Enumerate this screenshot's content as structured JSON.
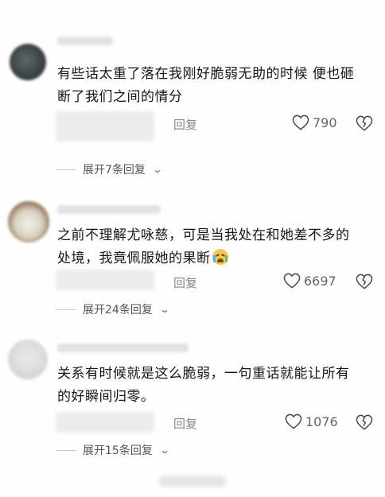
{
  "colors": {
    "background": "#fefefe",
    "text": "#161616",
    "secondary": "#888888",
    "heart_stroke": "#444444"
  },
  "comments": [
    {
      "text_line1": "有些话太重了落在我刚好脆弱无助的时候 便也砸",
      "text_line2": "断了我们之间的情分",
      "emoji": "",
      "reply_label": "回复",
      "likes": "790",
      "expand_label": "展开7条回复"
    },
    {
      "text_line1": "之前不理解尤咏慈，可是当我处在和她差不多的",
      "text_line2": "处境，我竟佩服她的果断",
      "emoji": "crying-face-emoji",
      "reply_label": "回复",
      "likes": "6697",
      "expand_label": "展开24条回复"
    },
    {
      "text_line1": "关系有时候就是这么脆弱，一句重话就能让所有",
      "text_line2": "的好瞬间归零。",
      "emoji": "",
      "reply_label": "回复",
      "likes": "1076",
      "expand_label": "展开15条回复"
    }
  ],
  "icons": {
    "like": "heart-outline-icon",
    "dislike": "broken-heart-icon",
    "expand": "chevron-down-icon"
  }
}
